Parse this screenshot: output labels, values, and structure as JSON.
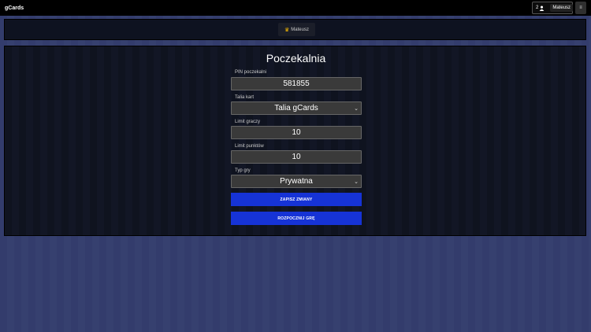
{
  "navbar": {
    "brand": "gCards",
    "player_count": "2",
    "username": "Mateusz",
    "menu_glyph": "≡"
  },
  "players": {
    "items": [
      {
        "name": "Mateusz",
        "icon": "crown-icon"
      }
    ]
  },
  "lobby": {
    "title": "Poczekalnia",
    "pin": {
      "label": "PIN poczekalni",
      "value": "581855"
    },
    "deck": {
      "label": "Talia kart",
      "value": "Talia gCards"
    },
    "player_limit": {
      "label": "Limit graczy",
      "value": "10"
    },
    "point_limit": {
      "label": "Limit punktów",
      "value": "10"
    },
    "game_type": {
      "label": "Typ gry",
      "value": "Prywatna"
    },
    "save_button": "ZAPISZ ZMIANY",
    "start_button": "ROZPOCZNIJ GRĘ"
  },
  "colors": {
    "accent": "#1633d6",
    "background": "#343e6e",
    "panel": "#0f131f",
    "crown": "#f5b800"
  }
}
